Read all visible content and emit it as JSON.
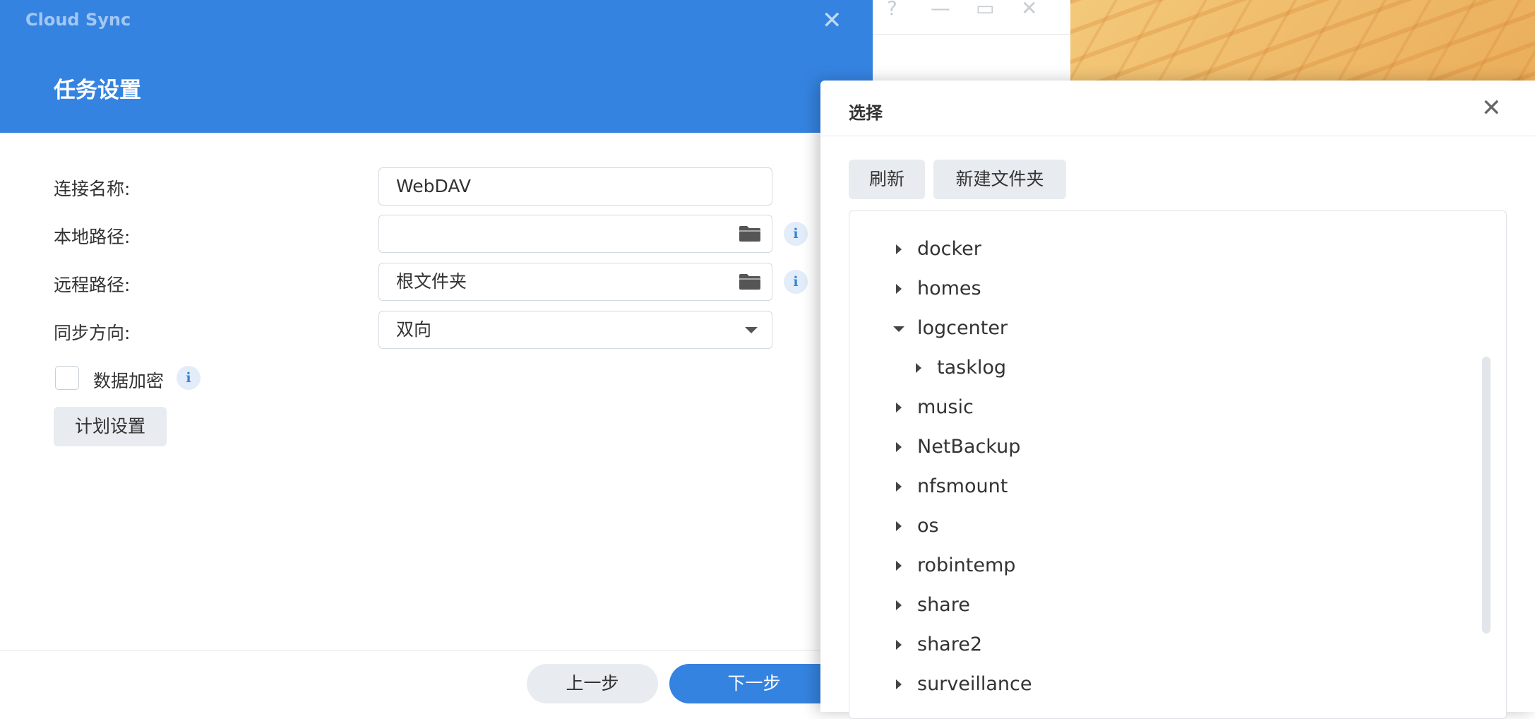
{
  "app": {
    "title": "Cloud Sync"
  },
  "wizard": {
    "heading": "任务设置",
    "fields": {
      "connection_name": {
        "label": "连接名称:",
        "value": "WebDAV"
      },
      "local_path": {
        "label": "本地路径:",
        "value": ""
      },
      "remote_path": {
        "label": "远程路径:",
        "value": "根文件夹"
      },
      "sync_direction": {
        "label": "同步方向:",
        "value": "双向"
      }
    },
    "encrypt_label": "数据加密",
    "encrypt_checked": false,
    "schedule_button": "计划设置",
    "info_glyph": "i",
    "prev_button": "上一步",
    "next_button": "下一步"
  },
  "background_window": {
    "controls": [
      "?",
      "—",
      "▭",
      "✕"
    ]
  },
  "chooser": {
    "title": "选择",
    "refresh_button": "刷新",
    "new_folder_button": "新建文件夹",
    "tree": [
      {
        "label": "docker",
        "expanded": false,
        "level": 0
      },
      {
        "label": "homes",
        "expanded": false,
        "level": 0
      },
      {
        "label": "logcenter",
        "expanded": true,
        "level": 0
      },
      {
        "label": "tasklog",
        "expanded": false,
        "level": 1
      },
      {
        "label": "music",
        "expanded": false,
        "level": 0
      },
      {
        "label": "NetBackup",
        "expanded": false,
        "level": 0
      },
      {
        "label": "nfsmount",
        "expanded": false,
        "level": 0
      },
      {
        "label": "os",
        "expanded": false,
        "level": 0
      },
      {
        "label": "robintemp",
        "expanded": false,
        "level": 0
      },
      {
        "label": "share",
        "expanded": false,
        "level": 0
      },
      {
        "label": "share2",
        "expanded": false,
        "level": 0
      },
      {
        "label": "surveillance",
        "expanded": false,
        "level": 0
      }
    ]
  },
  "colors": {
    "accent": "#3583e1",
    "button_gray": "#e8ecf0"
  }
}
